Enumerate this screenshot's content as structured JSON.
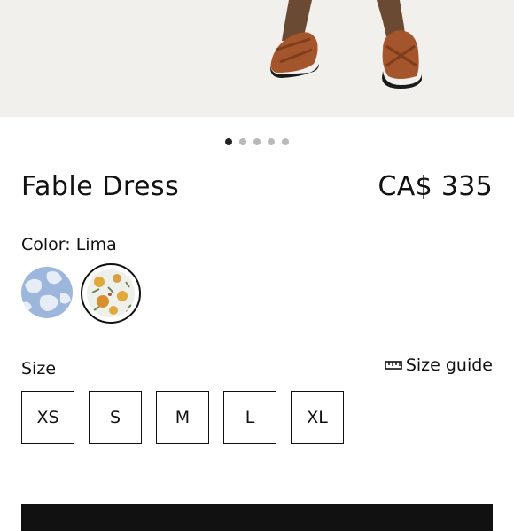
{
  "product": {
    "title": "Fable Dress",
    "price": "CA$ 335"
  },
  "gallery": {
    "image_count": 5,
    "active_index": 0
  },
  "color": {
    "label": "Color: Lima",
    "swatches": [
      {
        "name": "blue-floral-swatch",
        "selected": false
      },
      {
        "name": "lima-floral-swatch",
        "selected": true
      }
    ]
  },
  "size": {
    "label": "Size",
    "guide_label": "Size guide",
    "options": [
      "XS",
      "S",
      "M",
      "L",
      "XL"
    ]
  },
  "colors": {
    "accent": "#111111",
    "dot_inactive": "#b9b9b9",
    "hero_bg": "#f1f0ed"
  }
}
